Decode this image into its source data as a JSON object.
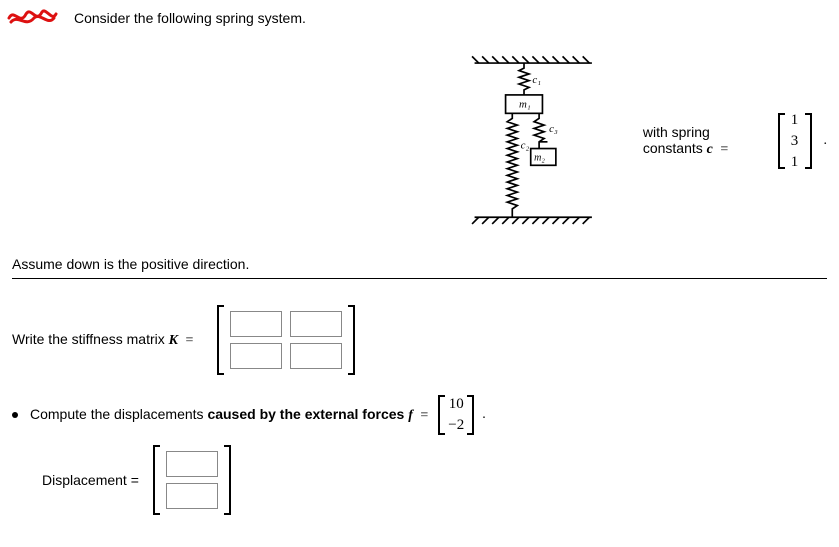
{
  "intro": "Consider the following spring system.",
  "diagram": {
    "labels": {
      "c1": "c₁",
      "c2": "c₂",
      "c3": "c₃",
      "m1": "m₁",
      "m2": "m₂"
    }
  },
  "constants_text": "with spring constants ",
  "c_symbol": "c",
  "c_vector": [
    "1",
    "3",
    "1"
  ],
  "assume_text": "Assume down is the positive direction.",
  "stiffness_prompt_pre": "Write the stiffness matrix ",
  "K_symbol": "K",
  "equals": " = ",
  "compute_prompt_pre": "Compute the displacements ",
  "compute_prompt_bold": "caused by the external forces ",
  "f_symbol": "f",
  "f_vector": [
    "10",
    "−2"
  ],
  "displacement_label": "Displacement ="
}
